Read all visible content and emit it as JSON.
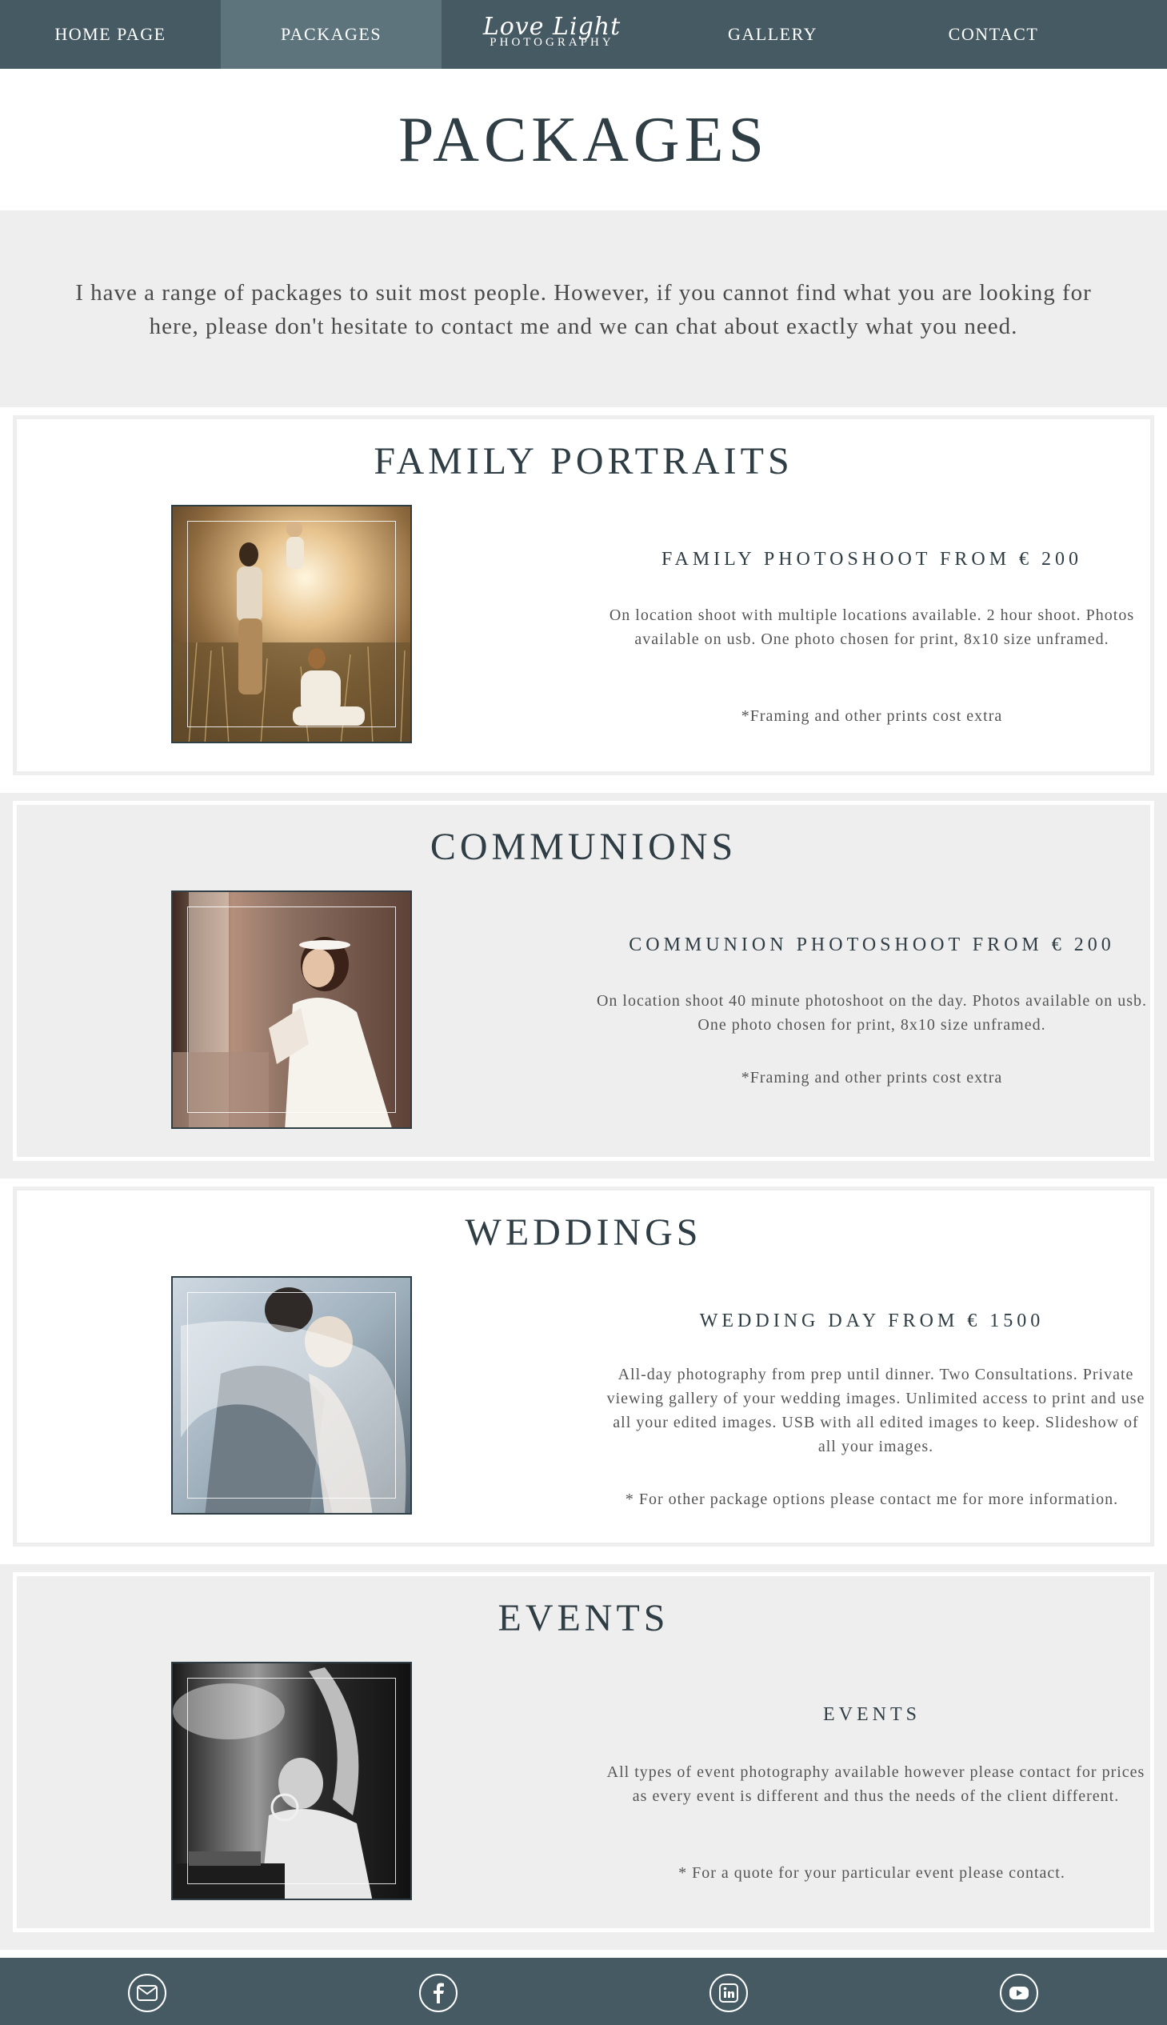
{
  "nav": {
    "items": [
      "HOME PAGE",
      "PACKAGES",
      "GALLERY",
      "CONTACT"
    ],
    "logo_script": "Love Light",
    "logo_sub": "PHOTOGRAPHY",
    "active": "PACKAGES"
  },
  "page_title": "PACKAGES",
  "intro": "I have a range of packages to suit most people. However, if you cannot find what you are looking for here, please don't hesitate to contact me and we can chat about exactly what you need.",
  "sections": [
    {
      "title": "FAMILY PORTRAITS",
      "package": "FAMILY PHOTOSHOOT FROM € 200",
      "description": "On location shoot with multiple locations available. 2 hour shoot. Photos available on usb. One photo chosen for print, 8x10 size unframed.",
      "note": "*Framing and other prints cost extra"
    },
    {
      "title": "COMMUNIONS",
      "package": "COMMUNION PHOTOSHOOT FROM € 200",
      "description": "On location shoot 40 minute photoshoot on the day. Photos available on usb. One photo chosen for print, 8x10 size unframed.",
      "note": "*Framing and other prints cost extra"
    },
    {
      "title": "WEDDINGS",
      "package": "WEDDING DAY FROM € 1500",
      "description": "All-day photography from prep until dinner. Two Consultations. Private viewing gallery of your wedding images. Unlimited access to print and use all your edited images. USB with all edited images to keep. Slideshow of all your images.",
      "note": "* For other package options please contact me for more information."
    },
    {
      "title": "EVENTS",
      "package": "EVENTS",
      "description": "All types of event photography available however please contact for prices as every event is different and thus the needs of the client different.",
      "note": "* For a quote for your particular event please contact."
    }
  ],
  "footer": {
    "icons": [
      "mail-icon",
      "facebook-icon",
      "linkedin-icon",
      "youtube-icon"
    ]
  },
  "colors": {
    "nav_bg": "#465a63",
    "nav_active": "#5d747d",
    "section_grey": "#eeeeee",
    "heading": "#2f3d45"
  }
}
